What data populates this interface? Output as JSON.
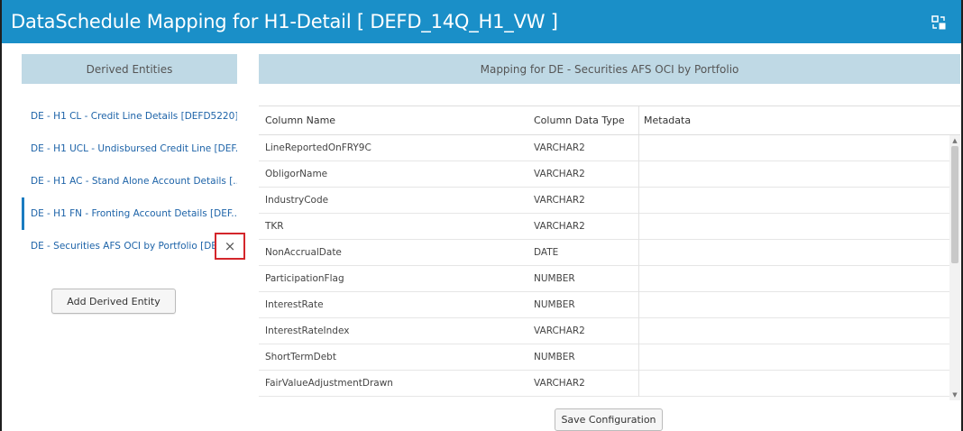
{
  "window": {
    "title": "DataSchedule Mapping for H1-Detail [ DEFD_14Q_H1_VW ]",
    "icon": "window-restore-icon"
  },
  "left_panel": {
    "header": "Derived Entities",
    "entities": [
      {
        "label": "DE - H1 CL - Credit Line Details [DEFD5220]"
      },
      {
        "label": "DE - H1 UCL - Undisbursed Credit Line [DEF..."
      },
      {
        "label": "DE - H1 AC - Stand Alone Account Details [..."
      },
      {
        "label": "DE - H1 FN - Fronting Account Details [DEF..."
      },
      {
        "label": "DE - Securities AFS OCI by Portfolio [DER..."
      }
    ],
    "remove_label": "×",
    "add_button": "Add Derived Entity"
  },
  "right_panel": {
    "header": "Mapping for DE - Securities AFS OCI by Portfolio",
    "columns": [
      "Column Name",
      "Column Data Type",
      "Metadata"
    ],
    "rows": [
      {
        "name": "LineReportedOnFRY9C",
        "type": "VARCHAR2",
        "metadata": ""
      },
      {
        "name": "ObligorName",
        "type": "VARCHAR2",
        "metadata": ""
      },
      {
        "name": "IndustryCode",
        "type": "VARCHAR2",
        "metadata": ""
      },
      {
        "name": "TKR",
        "type": "VARCHAR2",
        "metadata": ""
      },
      {
        "name": "NonAccrualDate",
        "type": "DATE",
        "metadata": ""
      },
      {
        "name": "ParticipationFlag",
        "type": "NUMBER",
        "metadata": ""
      },
      {
        "name": "InterestRate",
        "type": "NUMBER",
        "metadata": ""
      },
      {
        "name": "InterestRateIndex",
        "type": "VARCHAR2",
        "metadata": ""
      },
      {
        "name": "ShortTermDebt",
        "type": "NUMBER",
        "metadata": ""
      },
      {
        "name": "FairValueAdjustmentDrawn",
        "type": "VARCHAR2",
        "metadata": ""
      }
    ],
    "save_button": "Save Configuration"
  },
  "colors": {
    "title_bar": "#1a8fc8",
    "panel_header": "#bfd9e5",
    "link_text": "#1d63a8",
    "highlight_border": "#d4262b"
  }
}
